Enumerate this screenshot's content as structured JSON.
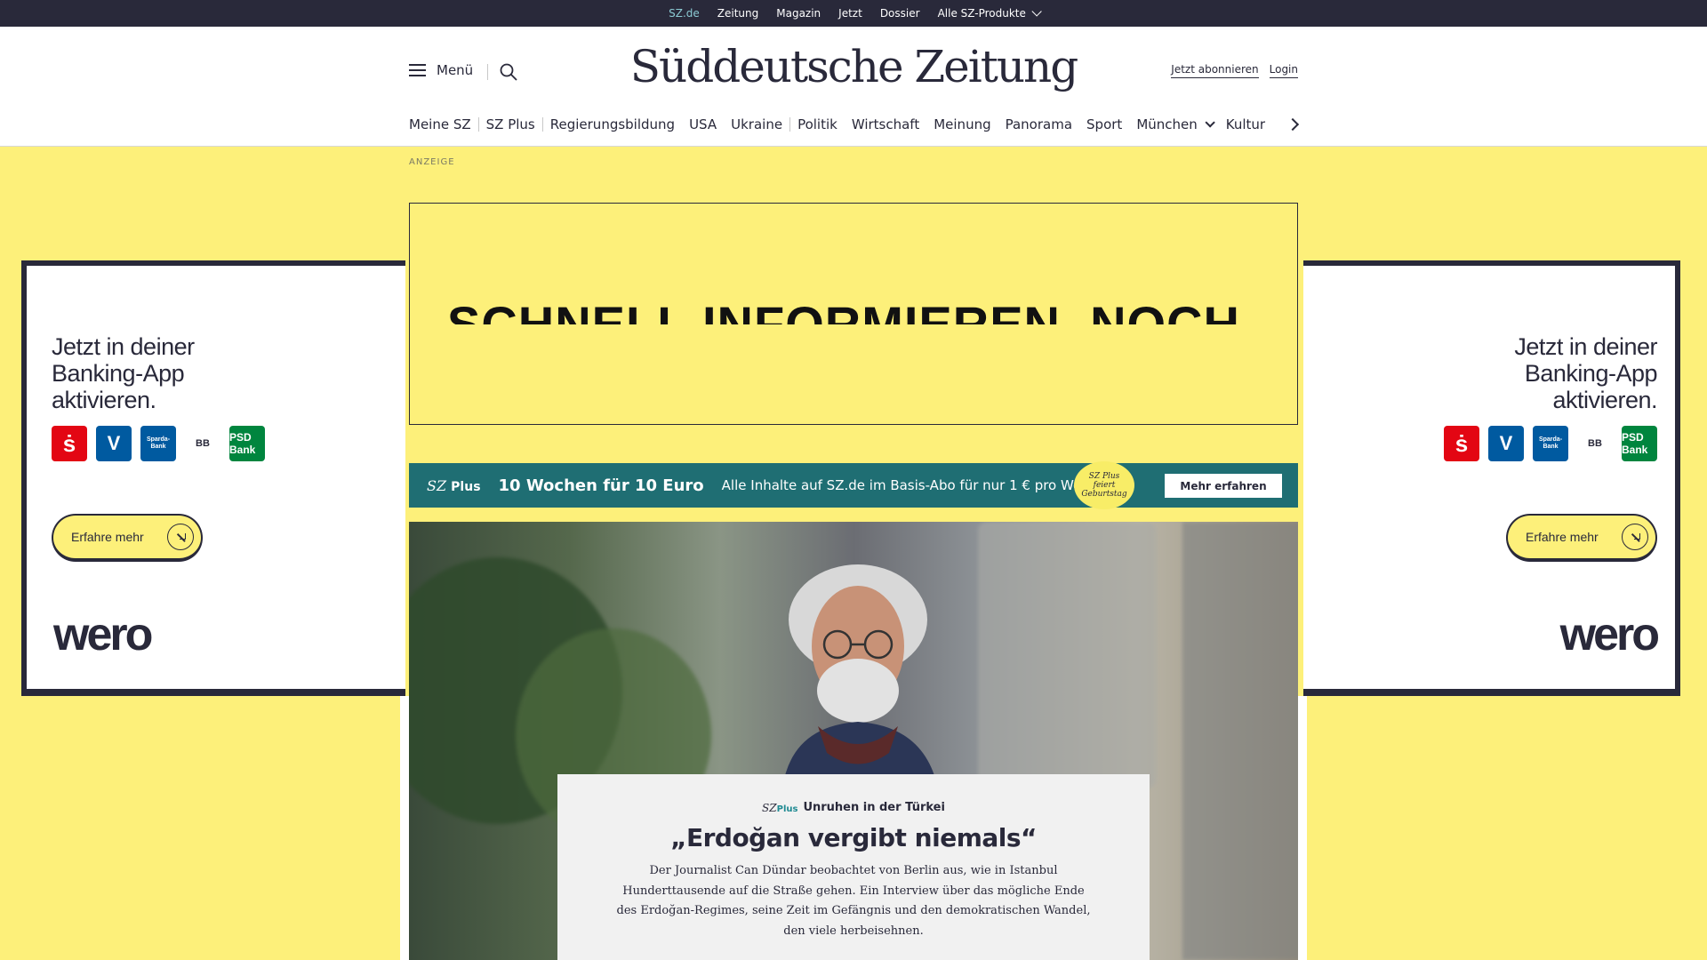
{
  "topbar": {
    "items": [
      "SZ.de",
      "Zeitung",
      "Magazin",
      "Jetzt",
      "Dossier"
    ],
    "products": "Alle SZ-Produkte"
  },
  "header": {
    "menu_label": "Menü",
    "logo": "Süddeutsche Zeitung",
    "subscribe": "Jetzt abonnieren",
    "login": "Login"
  },
  "nav": {
    "items": [
      "Meine SZ",
      "SZ Plus",
      "Regierungsbildung",
      "USA",
      "Ukraine",
      "Politik",
      "Wirtschaft",
      "Meinung",
      "Panorama",
      "Sport",
      "München",
      "Kultur"
    ]
  },
  "ad": {
    "label": "ANZEIGE",
    "banner_text": "SCHNELL INFORMIEREN. NOCH",
    "side_headline_1": "Jetzt in deiner",
    "side_headline_2": "Banking-App",
    "side_headline_3": "aktivieren.",
    "banks": [
      "Sparkasse",
      "Volksbanken Raiffeisenbanken",
      "Sparda-Bank",
      "BBBank",
      "PSD Bank"
    ],
    "bank_sparda": "Sparda-Bank",
    "bank_bb": "BB",
    "bank_psd": "PSD Bank",
    "cta": "Erfahre mehr",
    "brand": "wero",
    "brand_color": "#fdf07a"
  },
  "promo": {
    "logo_sz": "SZ",
    "logo_plus": "Plus",
    "title": "10 Wochen für 10 Euro",
    "description": "Alle Inhalte auf SZ.de im Basis-Abo für nur 1 € pro Woche.",
    "badge_line1": "SZ Plus",
    "badge_line2": "feiert",
    "badge_line3": "Geburtstag",
    "button": "Mehr erfahren",
    "color": "#1f6e73"
  },
  "teaser": {
    "kicker_sz": "SZ",
    "kicker_plus": "Plus",
    "kicker": "Unruhen in der Türkei",
    "headline": "„Erdoğan vergibt niemals“",
    "summary": "Der Journalist Can Dündar beobachtet von Berlin aus, wie in Istanbul Hunderttausende auf die Straße gehen. Ein Interview über das mögliche Ende des Erdoğan-Regimes, seine Zeit im Gefängnis und den demokratischen Wandel, den viele herbeisehnen."
  }
}
